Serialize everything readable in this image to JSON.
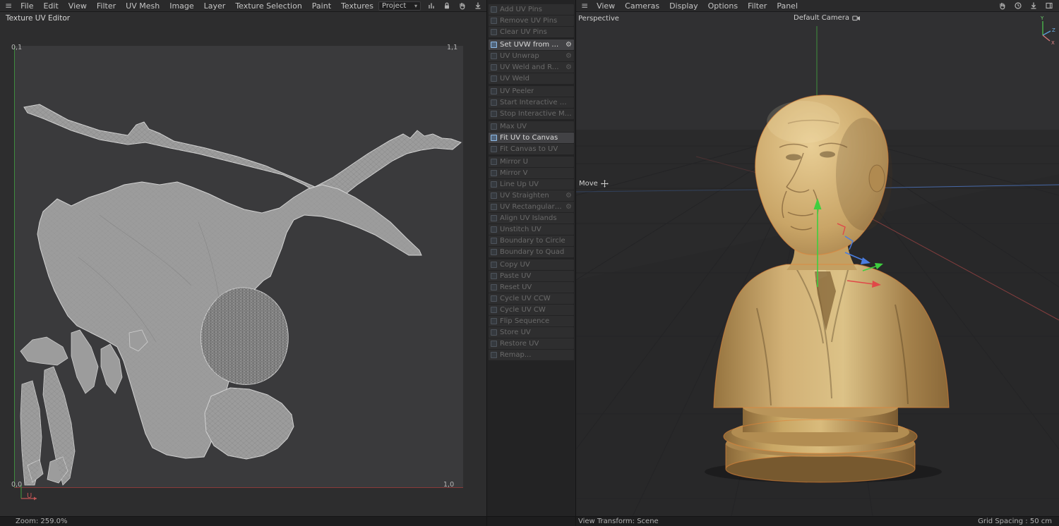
{
  "left_panel": {
    "title": "Texture UV Editor",
    "menu": [
      "File",
      "Edit",
      "View",
      "Filter",
      "UV Mesh",
      "Image",
      "Layer",
      "Texture Selection",
      "Paint",
      "Textures"
    ],
    "project_dropdown": "Project",
    "corners": {
      "top_left": "0,1",
      "top_right": "1,1",
      "bottom_left": "0,0",
      "bottom_right": "1,0"
    },
    "u_axis_label": "U",
    "status_zoom": "Zoom: 259.0%"
  },
  "uv_commands": {
    "groups": [
      {
        "items": [
          {
            "label": "Add UV Pins"
          },
          {
            "label": "Remove UV Pins"
          },
          {
            "label": "Clear UV Pins"
          }
        ]
      },
      {
        "items": [
          {
            "label": "Set UVW from Projection",
            "active": true,
            "gear": true
          },
          {
            "label": "UV Unwrap",
            "gear": true
          },
          {
            "label": "UV Weld and Relax",
            "gear": true
          },
          {
            "label": "UV Weld"
          }
        ]
      },
      {
        "items": [
          {
            "label": "UV Peeler"
          },
          {
            "label": "Start Interactive Mapping"
          },
          {
            "label": "Stop Interactive Mapping"
          }
        ]
      },
      {
        "items": [
          {
            "label": "Max UV"
          },
          {
            "label": "Fit UV to Canvas",
            "active": true
          },
          {
            "label": "Fit Canvas to UV"
          }
        ]
      },
      {
        "items": [
          {
            "label": "Mirror U"
          },
          {
            "label": "Mirror V"
          },
          {
            "label": "Line Up UV"
          },
          {
            "label": "UV Straighten",
            "gear": true
          },
          {
            "label": "UV Rectangularize",
            "gear": true
          },
          {
            "label": "Align UV Islands"
          },
          {
            "label": "Unstitch UV"
          },
          {
            "label": "Boundary to Circle"
          },
          {
            "label": "Boundary to Quad"
          }
        ]
      },
      {
        "items": [
          {
            "label": "Copy UV"
          },
          {
            "label": "Paste UV"
          },
          {
            "label": "Reset UV"
          },
          {
            "label": "Cycle UV CCW"
          },
          {
            "label": "Cycle UV CW"
          },
          {
            "label": "Flip Sequence"
          },
          {
            "label": "Store UV"
          },
          {
            "label": "Restore UV"
          },
          {
            "label": "Remap..."
          }
        ]
      }
    ]
  },
  "viewport": {
    "menu": [
      "View",
      "Cameras",
      "Display",
      "Options",
      "Filter",
      "Panel"
    ],
    "view_label": "Perspective",
    "camera_label": "Default Camera",
    "tool_label": "Move",
    "axis_labels": {
      "y": "Y",
      "z": "Z",
      "x": "X"
    },
    "status_left": "View Transform: Scene",
    "status_right": "Grid Spacing : 50 cm"
  },
  "icons": {
    "hamburger": "≡",
    "caret": "▾",
    "gear": "⚙"
  },
  "colors": {
    "selection_outline": "#e0853a",
    "axis_x": "#c25555",
    "axis_y": "#3ecf3e",
    "axis_z": "#4a7de0",
    "uv_island_gray": "#9c9c9c",
    "canvas_bg": "#3a3a3c",
    "panel_bg": "#2d2d2e"
  }
}
